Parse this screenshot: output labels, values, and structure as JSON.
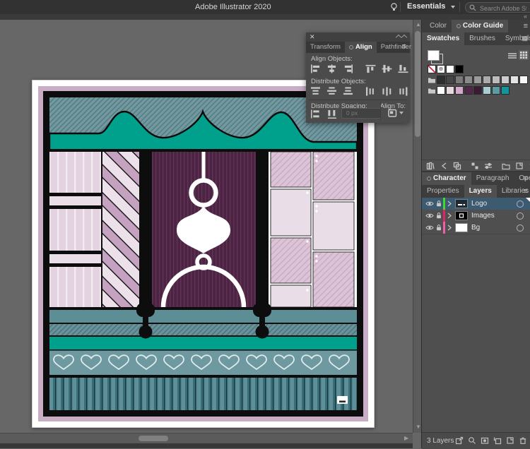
{
  "app": {
    "title": "Adobe Illustrator 2020",
    "workspace": "Essentials",
    "search_placeholder": "Search Adobe Stock"
  },
  "align_panel": {
    "tabs": [
      "Transform",
      "Align",
      "Pathfinder"
    ],
    "active_tab": "Align",
    "align_objects_label": "Align Objects:",
    "distribute_objects_label": "Distribute Objects:",
    "distribute_spacing_label": "Distribute Spacing:",
    "align_to_label": "Align To:",
    "spacing_value": "0 px",
    "align_icons": [
      "horizontal-align-left",
      "horizontal-align-center",
      "horizontal-align-right",
      "vertical-align-top",
      "vertical-align-center",
      "vertical-align-bottom"
    ],
    "distribute_icons": [
      "vertical-distribute-top",
      "vertical-distribute-center",
      "vertical-distribute-bottom",
      "horizontal-distribute-left",
      "horizontal-distribute-center",
      "horizontal-distribute-right"
    ],
    "spacing_icons": [
      "vertical-distribute-space",
      "horizontal-distribute-space"
    ]
  },
  "dock": {
    "color_tabs": [
      "Color",
      "Color Guide"
    ],
    "color_active": "Color Guide",
    "swatch_tabs": [
      "Swatches",
      "Brushes",
      "Symbols"
    ],
    "swatch_active": "Swatches",
    "swatches": {
      "special": [
        "none",
        "registration",
        "white",
        "black"
      ],
      "grays": [
        "#2e2e2e",
        "#464646",
        "#7a7a7a",
        "#8a8a8a",
        "#9a9a9a",
        "#ababab",
        "#bcbcbc",
        "#cdcdcd",
        "#e4e4e4",
        "#f6f6f6"
      ],
      "theme": [
        "#ffffff",
        "#e8d9e4",
        "#d5a9cb",
        "#53274a",
        "#3a1b33",
        "#a9ccd1",
        "#5f99a3",
        "#0f97a0"
      ]
    },
    "type_tabs": [
      "Character",
      "Paragraph",
      "OpenType"
    ],
    "type_active": "Character",
    "panel_tabs": [
      "Properties",
      "Layers",
      "Libraries"
    ],
    "panel_active": "Layers",
    "layers": [
      {
        "name": "Logo",
        "color": "#44d62c",
        "selected": true
      },
      {
        "name": "Images",
        "color": "#e0246a",
        "selected": false
      },
      {
        "name": "Bg",
        "color": "#ee5fa7",
        "selected": false
      }
    ],
    "status": "3 Layers"
  },
  "artwork": {
    "palette": {
      "bright_teal": "#00a18c",
      "muted_teal": "#75989f",
      "deep_teal_stripe": "#3a6e77",
      "maroon": "#4c2343",
      "pale_pink": "#e9dee8",
      "pink": "#dcc4d7",
      "mauve": "#c5a2c0",
      "frame_black": "#0d0d0d",
      "border_mauve": "#c9adc5"
    }
  }
}
